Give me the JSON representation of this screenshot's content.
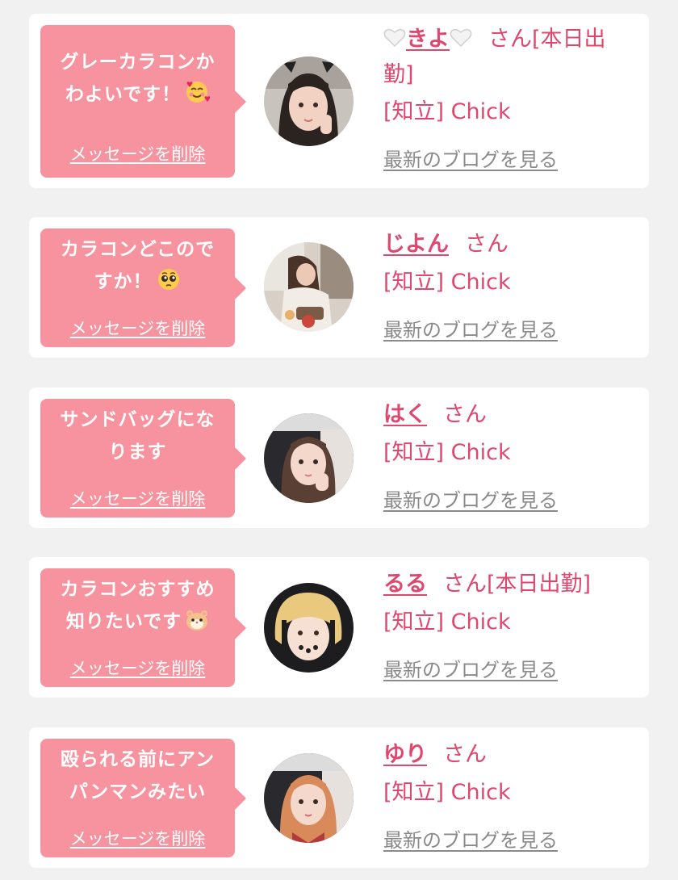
{
  "delete_label": "メッセージを削除",
  "blog_label": "最新のブログを見る",
  "san_label": "さん",
  "shop_label": "[知立] Chick",
  "colors": {
    "background": "#f1f1f1",
    "card": "#ffffff",
    "bubble": "#f7939f",
    "accent": "#e0476f",
    "link_gray": "#8a8a8a"
  },
  "cards": [
    {
      "message_lines": [
        "グレーカラコンか",
        "わよいです！"
      ],
      "message_emoji": "smiling-face-with-hearts-icon",
      "name": "きよ",
      "name_decoration": "white-heart-icon",
      "status": "[本日出",
      "status_cont": "勤]"
    },
    {
      "message_lines": [
        "カラコンどこので",
        "すか！"
      ],
      "message_emoji": "pleading-face-icon",
      "name": "じよん",
      "status": ""
    },
    {
      "message_lines": [
        "サンドバッグにな",
        "ります"
      ],
      "message_emoji": "",
      "name": "はく",
      "status": ""
    },
    {
      "message_lines": [
        "カラコンおすすめ",
        "知りたいです"
      ],
      "message_emoji": "hamster-icon",
      "name": "るる",
      "status": "[本日出勤]"
    },
    {
      "message_lines": [
        "殴られる前にアン",
        "パンマンみたい"
      ],
      "message_emoji": "",
      "name": "ゆり",
      "status": ""
    }
  ]
}
